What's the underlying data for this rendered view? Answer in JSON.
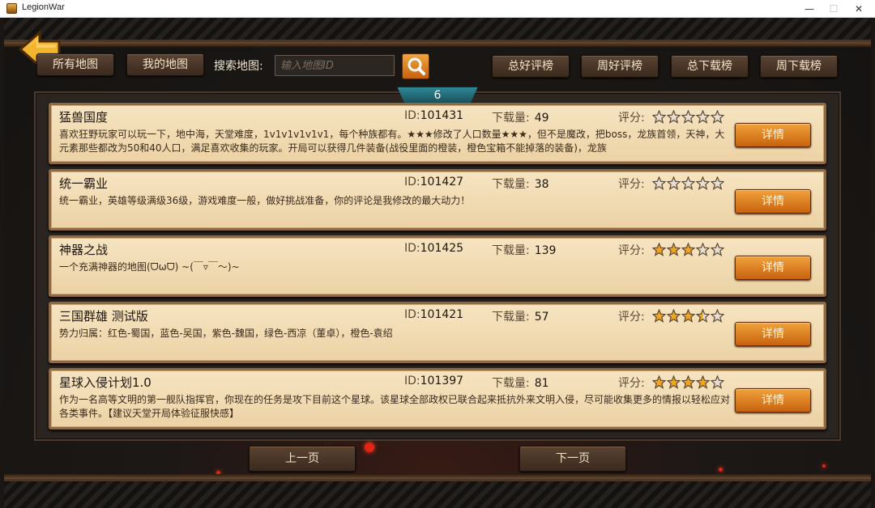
{
  "window": {
    "title": "LegionWar",
    "min_glyph": "—",
    "max_glyph": "☐",
    "close_glyph": "✕"
  },
  "nav": {
    "all_maps": "所有地图",
    "my_maps": "我的地图",
    "search_label": "搜索地图:",
    "search_placeholder": "输入地图ID",
    "search_value": ""
  },
  "rank_tabs": {
    "total_rating": "总好评榜",
    "weekly_rating": "周好评榜",
    "total_downloads": "总下载榜",
    "weekly_downloads": "周下载榜"
  },
  "page_number": "6",
  "labels": {
    "id": "ID:",
    "downloads": "下载量:",
    "rating": "评分:",
    "detail": "详情"
  },
  "maps": [
    {
      "name": "猛兽国度",
      "id": "101431",
      "downloads": "49",
      "stars": 0,
      "desc": "喜欢狂野玩家可以玩一下，地中海，天堂难度，1v1v1v1v1v1，每个种族都有。★★★修改了人口数量★★★，但不是魔改，把boss，龙族首领，天神，大元素那些都改为50和40人口，满足喜欢收集的玩家。开局可以获得几件装备(战役里面的橙装，橙色宝箱不能掉落的装备)，龙族"
    },
    {
      "name": "统一霸业",
      "id": "101427",
      "downloads": "38",
      "stars": 0,
      "desc": "统一霸业，英雄等级满级36级，游戏难度一般，做好挑战准备，你的评论是我修改的最大动力！"
    },
    {
      "name": "神器之战",
      "id": "101425",
      "downloads": "139",
      "stars": 3,
      "desc": "一个充满神器的地图(ᗜωᗜ) ~(￣▿￣～)~"
    },
    {
      "name": "三国群雄 测试版",
      "id": "101421",
      "downloads": "57",
      "stars": 3.5,
      "desc": "势力归属：红色-蜀国，蓝色-吴国，紫色-魏国，绿色-西凉（董卓），橙色-袁绍"
    },
    {
      "name": "星球入侵计划1.0",
      "id": "101397",
      "downloads": "81",
      "stars": 4,
      "desc": "作为一名高等文明的第一舰队指挥官，你现在的任务是攻下目前这个星球。该星球全部政权已联合起来抵抗外来文明入侵，尽可能收集更多的情报以轻松应对各类事件。【建议天堂开局体验征服快感】"
    }
  ],
  "pager": {
    "prev": "上一页",
    "next": "下一页"
  },
  "colors": {
    "card_bg": "#f3ddb6",
    "accent_orange": "#e0851f",
    "tab_teal": "#2a7a88"
  }
}
